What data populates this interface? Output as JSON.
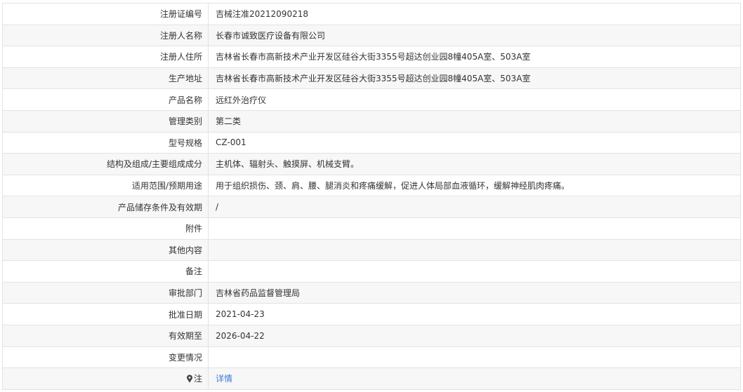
{
  "rows": [
    {
      "label": "注册证编号",
      "value": "吉械注准20212090218"
    },
    {
      "label": "注册人名称",
      "value": "长春市诚致医疗设备有限公司"
    },
    {
      "label": "注册人住所",
      "value": "吉林省长春市高新技术产业开发区硅谷大街3355号超达创业园8幢405A室、503A室"
    },
    {
      "label": "生产地址",
      "value": "吉林省长春市高新技术产业开发区硅谷大街3355号超达创业园8幢405A室、503A室"
    },
    {
      "label": "产品名称",
      "value": "远红外治疗仪"
    },
    {
      "label": "管理类别",
      "value": "第二类"
    },
    {
      "label": "型号规格",
      "value": "CZ-001"
    },
    {
      "label": "结构及组成/主要组成成分",
      "value": "主机体、辐射头、触摸屏、机械支臂。"
    },
    {
      "label": "适用范围/预期用途",
      "value": "用于组织损伤、颈、肩、腰、腿消炎和疼痛缓解，促进人体局部血液循环，缓解神经肌肉疼痛。"
    },
    {
      "label": "产品储存条件及有效期",
      "value": "/"
    },
    {
      "label": "附件",
      "value": ""
    },
    {
      "label": "其他内容",
      "value": ""
    },
    {
      "label": "备注",
      "value": ""
    },
    {
      "label": "审批部门",
      "value": "吉林省药品监督管理局"
    },
    {
      "label": "批准日期",
      "value": "2021-04-23"
    },
    {
      "label": "有效期至",
      "value": "2026-04-22"
    },
    {
      "label": "变更情况",
      "value": ""
    }
  ],
  "note": {
    "icon": "pin-icon",
    "label": "注",
    "link_text": "详情",
    "link_color": "#3a7bd5"
  }
}
